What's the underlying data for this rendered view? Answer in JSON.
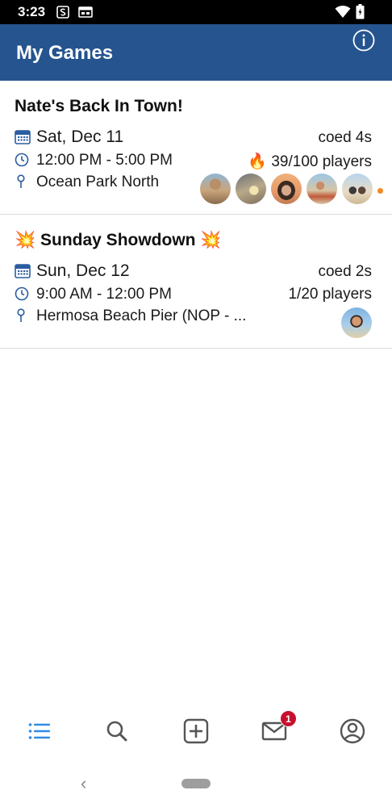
{
  "status_bar": {
    "time": "3:23",
    "icons": [
      "notification-s-icon",
      "window-icon",
      "wifi-icon",
      "battery-icon"
    ]
  },
  "app_bar": {
    "title": "My Games",
    "info_icon": "info-icon",
    "color": "#25548f"
  },
  "games": [
    {
      "title": "Nate's Back In Town!",
      "date": "Sat, Dec 11",
      "time": "12:00 PM - 5:00 PM",
      "location": "Ocean Park North",
      "format": "coed 4s",
      "players": "39/100 players",
      "players_emoji": "🔥",
      "avatars": 5,
      "more_indicator_color": "#f08a24"
    },
    {
      "title": "Sunday Showdown",
      "title_emoji": "💥",
      "date": "Sun, Dec 12",
      "time": "9:00 AM - 12:00 PM",
      "location": "Hermosa Beach Pier (NOP - ...",
      "format": "coed 2s",
      "players": "1/20 players",
      "avatars": 1
    }
  ],
  "bottom_nav": {
    "items": [
      "list-icon",
      "search-icon",
      "add-icon",
      "mail-icon",
      "profile-icon"
    ],
    "active_index": 0,
    "active_color": "#2f8be6",
    "inactive_color": "#555555",
    "mail_badge": "1"
  }
}
